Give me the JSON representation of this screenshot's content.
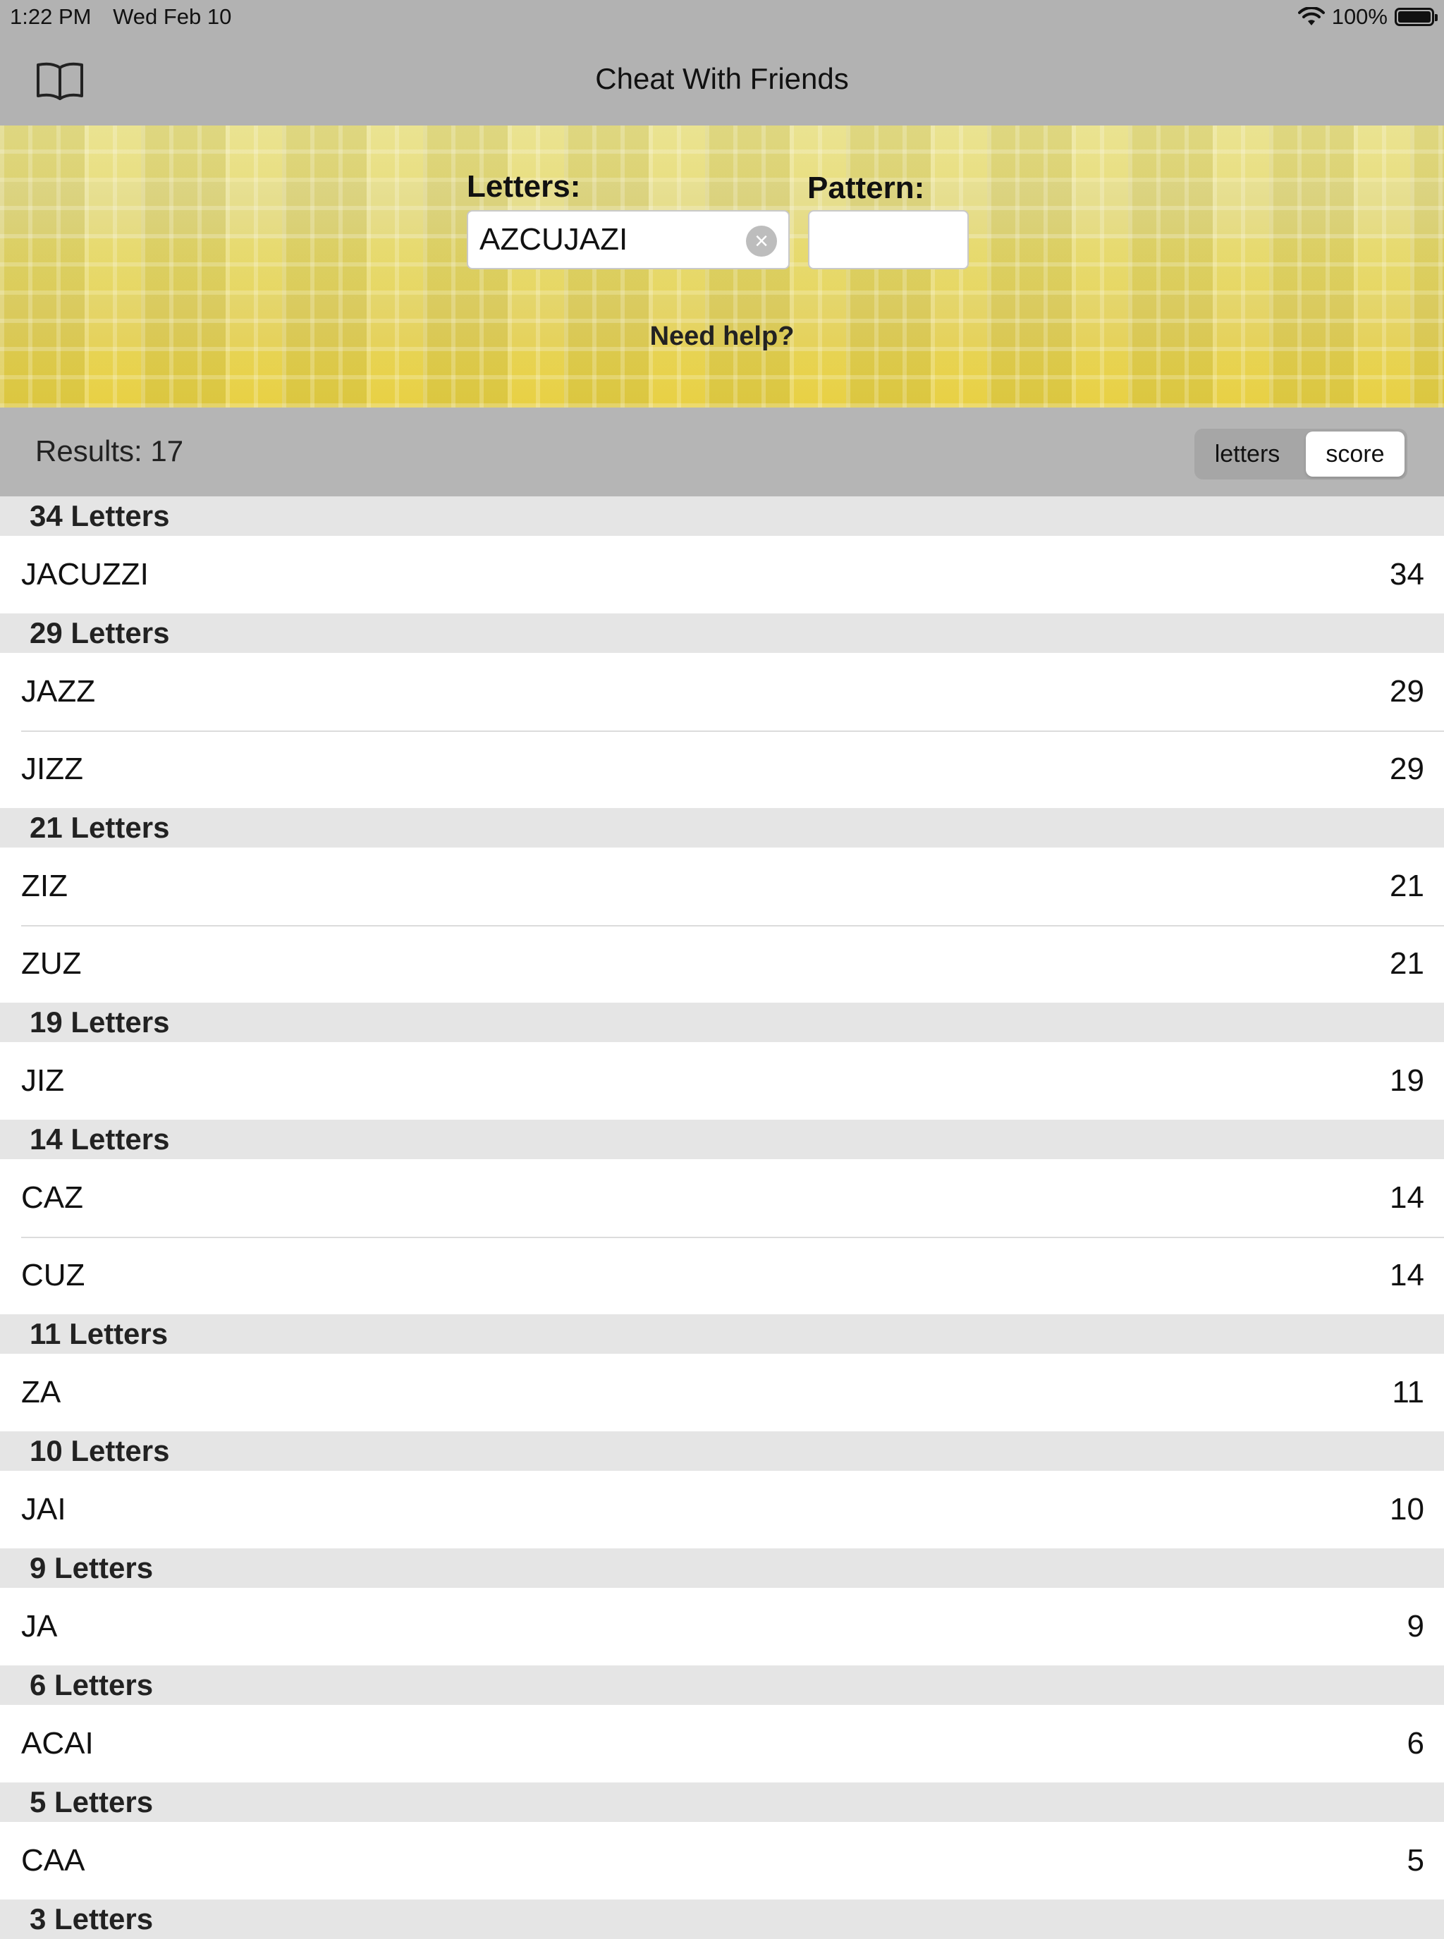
{
  "status_bar": {
    "time": "1:22 PM",
    "date": "Wed Feb 10",
    "battery": "100%"
  },
  "nav": {
    "title": "Cheat With Friends",
    "book_icon": "book-icon"
  },
  "search": {
    "letters_label": "Letters:",
    "letters_value": "AZCUJAZI",
    "pattern_label": "Pattern:",
    "pattern_value": "",
    "help_link": "Need help?"
  },
  "results": {
    "count_label": "Results: 17",
    "sort_options": [
      "letters",
      "score"
    ],
    "selected_sort": "score"
  },
  "sections": [
    {
      "header": "34 Letters",
      "rows": [
        {
          "word": "JACUZZI",
          "score": "34"
        }
      ]
    },
    {
      "header": "29 Letters",
      "rows": [
        {
          "word": "JAZZ",
          "score": "29"
        },
        {
          "word": "JIZZ",
          "score": "29"
        }
      ]
    },
    {
      "header": "21 Letters",
      "rows": [
        {
          "word": "ZIZ",
          "score": "21"
        },
        {
          "word": "ZUZ",
          "score": "21"
        }
      ]
    },
    {
      "header": "19 Letters",
      "rows": [
        {
          "word": "JIZ",
          "score": "19"
        }
      ]
    },
    {
      "header": "14 Letters",
      "rows": [
        {
          "word": "CAZ",
          "score": "14"
        },
        {
          "word": "CUZ",
          "score": "14"
        }
      ]
    },
    {
      "header": "11 Letters",
      "rows": [
        {
          "word": "ZA",
          "score": "11"
        }
      ]
    },
    {
      "header": "10 Letters",
      "rows": [
        {
          "word": "JAI",
          "score": "10"
        }
      ]
    },
    {
      "header": "9 Letters",
      "rows": [
        {
          "word": "JA",
          "score": "9"
        }
      ]
    },
    {
      "header": "6 Letters",
      "rows": [
        {
          "word": "ACAI",
          "score": "6"
        }
      ]
    },
    {
      "header": "5 Letters",
      "rows": [
        {
          "word": "CAA",
          "score": "5"
        }
      ]
    },
    {
      "header": "3 Letters",
      "rows": []
    }
  ]
}
